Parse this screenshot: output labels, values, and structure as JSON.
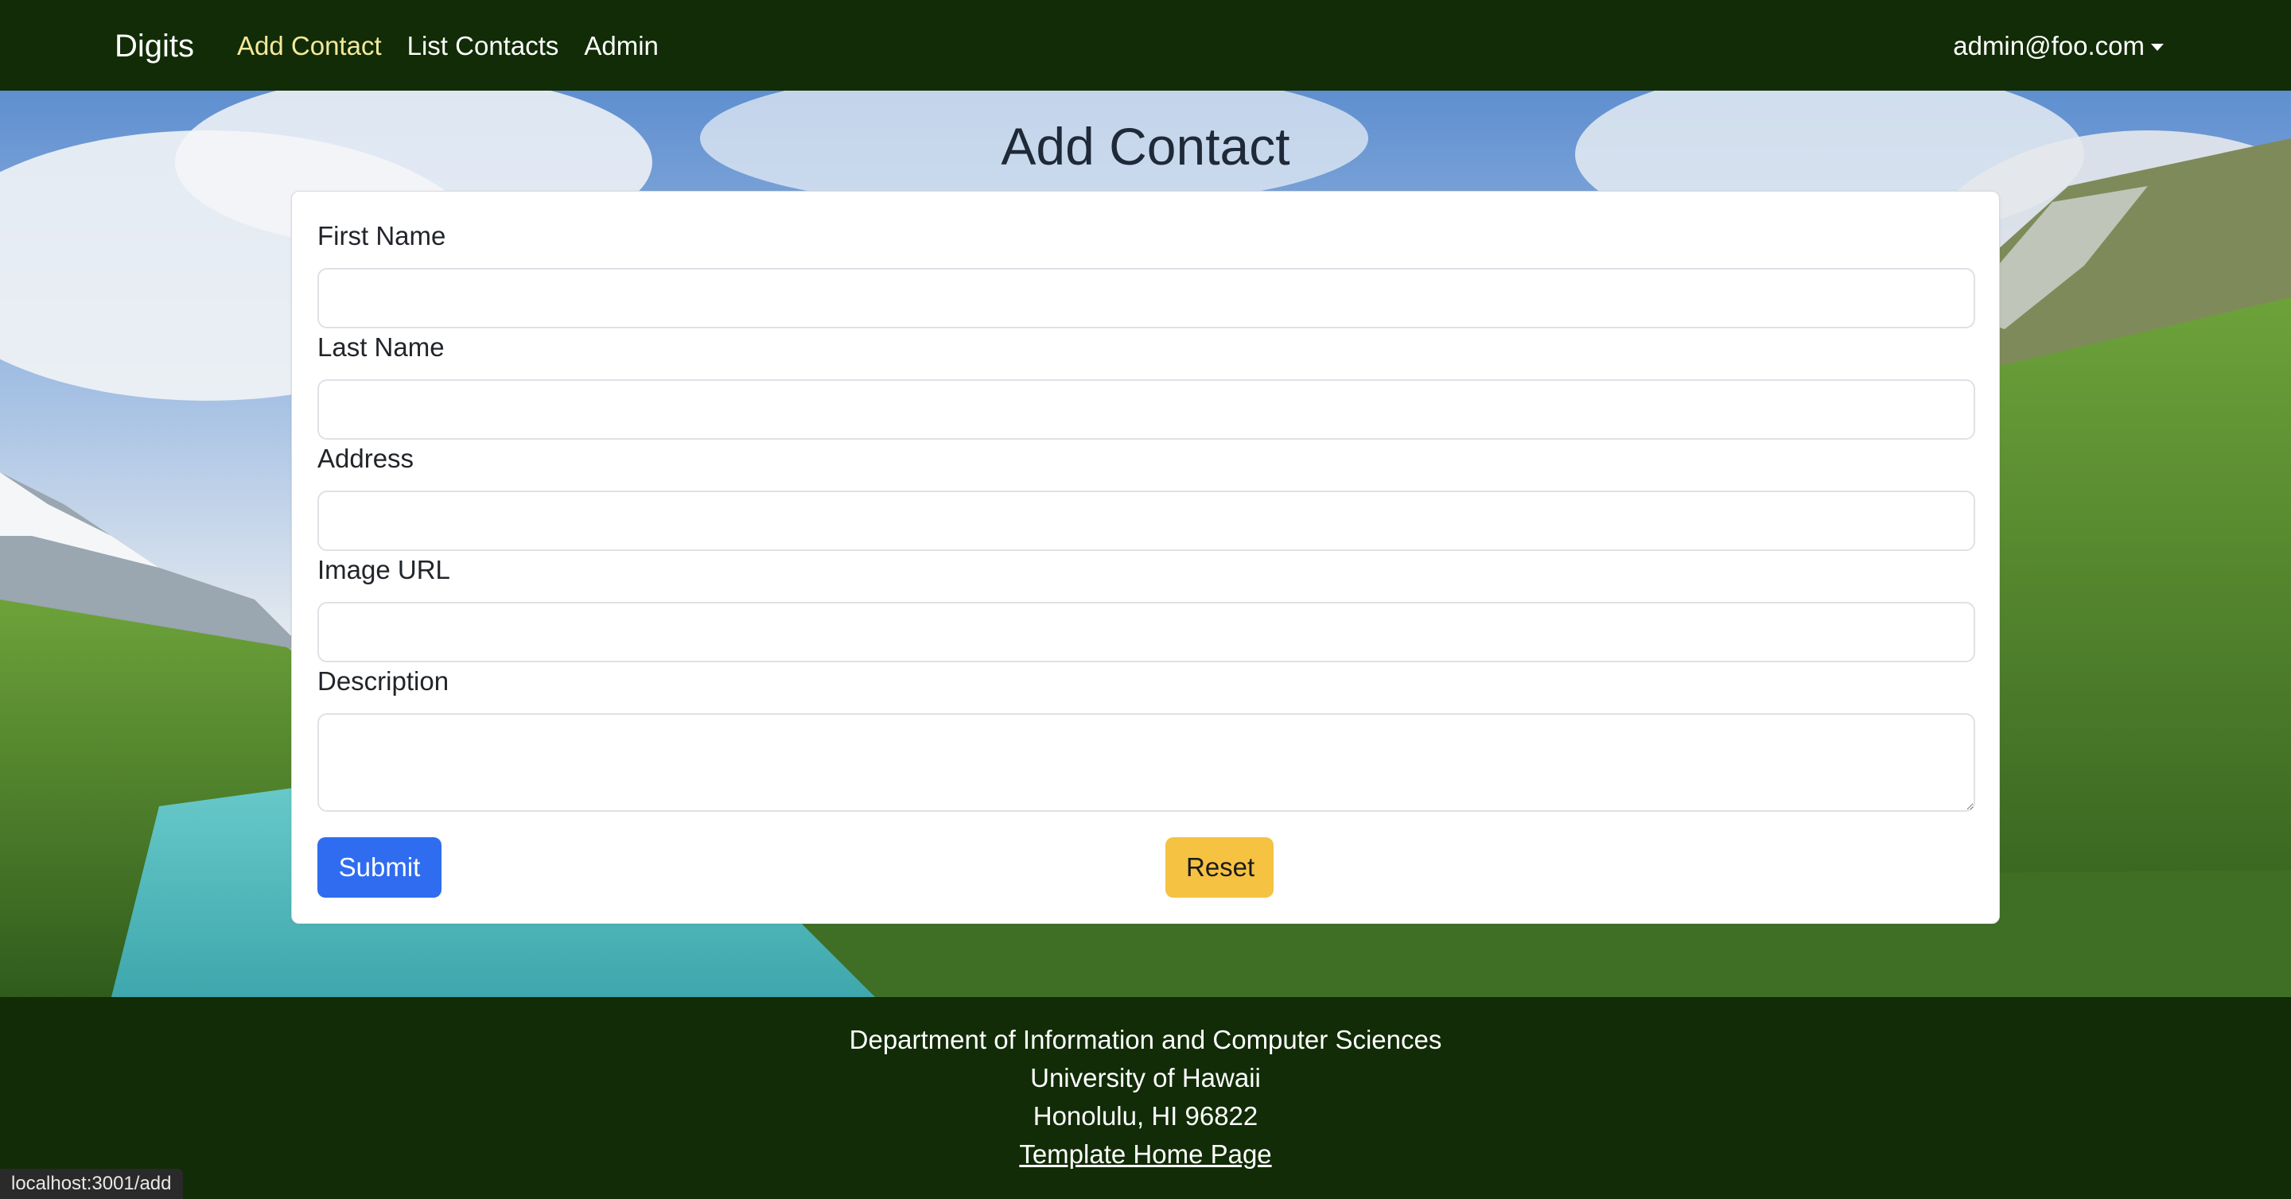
{
  "navbar": {
    "brand": "Digits",
    "links": [
      {
        "label": "Add Contact",
        "active": true
      },
      {
        "label": "List Contacts",
        "active": false
      },
      {
        "label": "Admin",
        "active": false
      }
    ],
    "user": "admin@foo.com"
  },
  "page": {
    "title": "Add Contact"
  },
  "form": {
    "fields": [
      {
        "label": "First Name",
        "value": "",
        "placeholder": ""
      },
      {
        "label": "Last Name",
        "value": "",
        "placeholder": ""
      },
      {
        "label": "Address",
        "value": "",
        "placeholder": ""
      },
      {
        "label": "Image URL",
        "value": "",
        "placeholder": ""
      },
      {
        "label": "Description",
        "value": "",
        "placeholder": ""
      }
    ],
    "submit_label": "Submit",
    "reset_label": "Reset"
  },
  "footer": {
    "line1": "Department of Information and Computer Sciences",
    "line2": "University of Hawaii",
    "line3": "Honolulu, HI 96822",
    "link": "Template Home Page"
  },
  "status_bar": {
    "url": "localhost:3001/add"
  },
  "colors": {
    "navbar_bg": "#112c06",
    "active_link": "#f4e89c",
    "submit_bg": "#2f6cf0",
    "reset_bg": "#f5c242"
  }
}
